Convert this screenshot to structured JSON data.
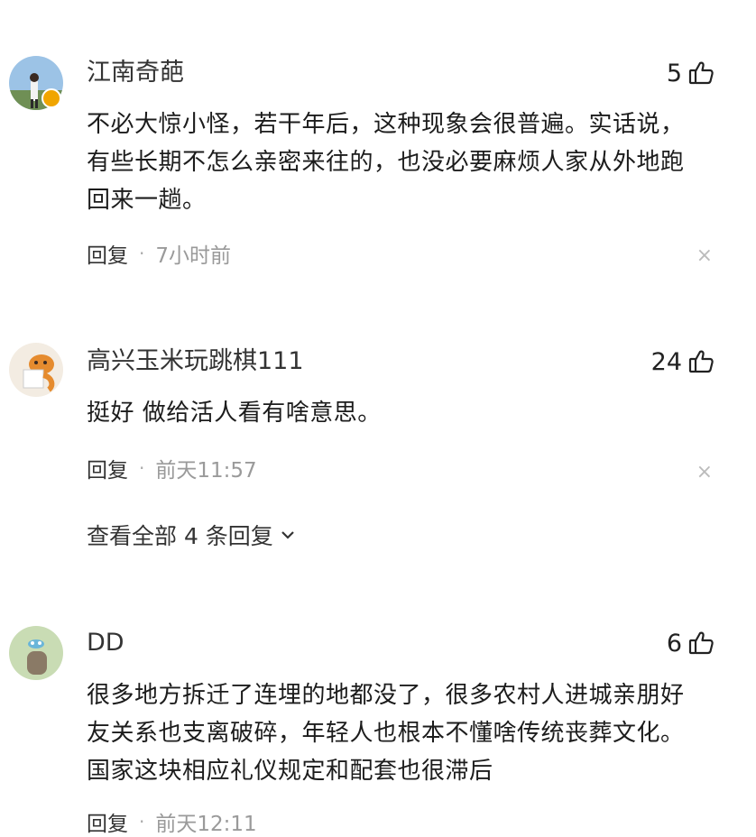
{
  "comments": [
    {
      "username": "江南奇葩",
      "likes": "5",
      "lines": [
        "不必大惊小怪，若干年后，这种现象会很普遍。实话说，",
        "有些长期不怎么亲密来往的，也没必要麻烦人家从外地跑",
        "回来一趟。"
      ],
      "reply_label": "回复",
      "separator": "·",
      "time": "7小时前",
      "close": "×"
    },
    {
      "username": "高兴玉米玩跳棋111",
      "likes": "24",
      "lines": [
        "挺好 做给活人看有啥意思。"
      ],
      "reply_label": "回复",
      "separator": "·",
      "time": "前天11:57",
      "close": "×",
      "view_all": "查看全部 4 条回复"
    },
    {
      "username": "DD",
      "likes": "6",
      "lines": [
        "很多地方拆迁了连埋的地都没了，很多农村人进城亲朋好",
        "友关系也支离破碎，年轻人也根本不懂啥传统丧葬文化。",
        "国家这块相应礼仪规定和配套也很滞后"
      ],
      "reply_label": "回复",
      "separator": "·",
      "time": "前天12:11"
    }
  ],
  "icons": {
    "like": "thumbs-up-icon",
    "close": "close-icon",
    "chevron": "chevron-down-icon",
    "badge": "verified-badge-icon"
  },
  "colors": {
    "text": "#1c1c1c",
    "meta": "#9a9a9a",
    "badge": "#f0a500"
  }
}
